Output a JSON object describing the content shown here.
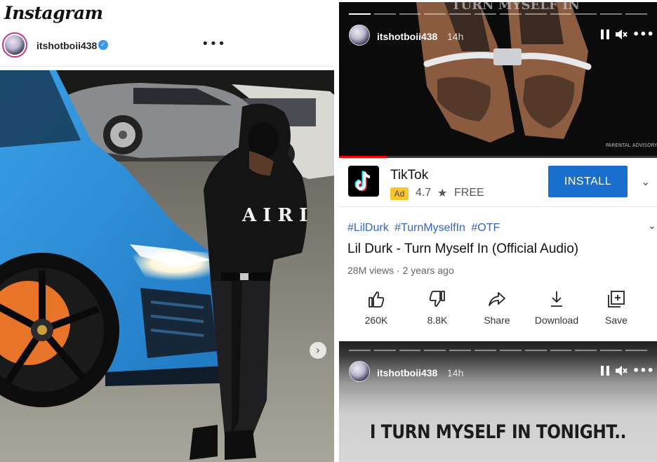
{
  "instagram": {
    "logo_text": "Instagram",
    "username": "itshotboii438",
    "verified": true,
    "more_glyph": "•••",
    "next_glyph": "›",
    "photo_subject": "person in black hoodie posing beside a light blue Lamborghini Urus at night",
    "colors": {
      "verified_badge": "#3897f0",
      "avatar_ring": "#c13584",
      "car_blue": "#2f8fd6",
      "caliper_orange": "#e8742a"
    }
  },
  "story_top": {
    "username": "itshotboii438",
    "time": "14h",
    "segments_total": 12,
    "segments_done": 1,
    "controls": {
      "pause": "pause-icon",
      "mute": "muted-speaker-icon",
      "more": "•••"
    },
    "video_subject": "tattooed hands with diamond chain cuffs",
    "video_progress": 0.15
  },
  "ad": {
    "app_name": "TikTok",
    "badge": "Ad",
    "rating": "4.7",
    "star_glyph": "★",
    "price": "FREE",
    "install_label": "INSTALL",
    "chevron": "⌄",
    "colors": {
      "install": "#1a6fce",
      "badge": "#f9c52b"
    }
  },
  "video": {
    "tags": [
      "#LilDurk",
      "#TurnMyselfIn",
      "#OTF"
    ],
    "title": "Lil Durk - Turn Myself In (Official Audio)",
    "views": "28M views",
    "separator": "·",
    "age": "2 years ago",
    "chevron": "⌄",
    "actions": [
      {
        "icon": "thumbs-up-icon",
        "label": "260K"
      },
      {
        "icon": "thumbs-down-icon",
        "label": "8.8K"
      },
      {
        "icon": "share-icon",
        "label": "Share"
      },
      {
        "icon": "download-icon",
        "label": "Download"
      },
      {
        "icon": "save-icon",
        "label": "Save"
      }
    ],
    "colors": {
      "tags": "#3166c3"
    }
  },
  "story_bottom": {
    "username": "itshotboii438",
    "time": "14h",
    "segments_total": 12,
    "segments_done": 0,
    "caption": "I TURN MYSELF IN TONIGHT.."
  }
}
